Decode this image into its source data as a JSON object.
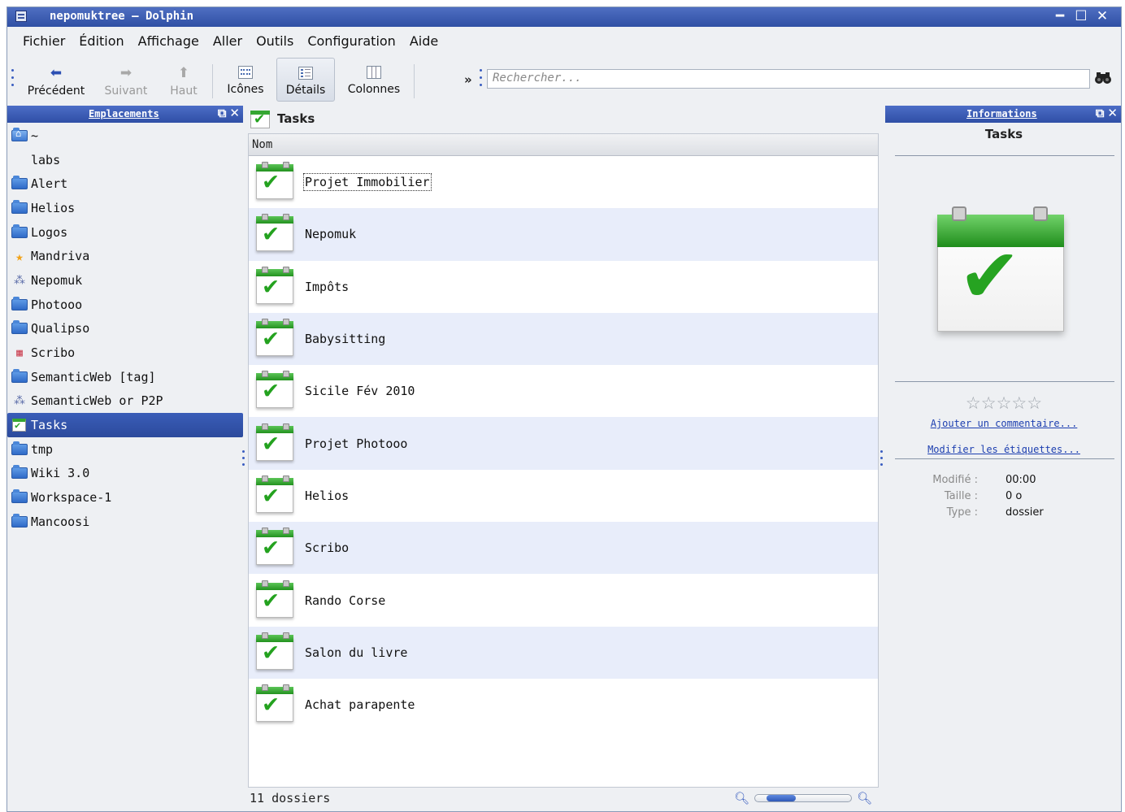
{
  "window": {
    "title": "nepomuktree – Dolphin",
    "controls": [
      "━",
      "☐",
      "✕"
    ]
  },
  "menu": [
    "Fichier",
    "Édition",
    "Affichage",
    "Aller",
    "Outils",
    "Configuration",
    "Aide"
  ],
  "toolbar": {
    "back": "Précédent",
    "forward": "Suivant",
    "up": "Haut",
    "icons": "Icônes",
    "details": "Détails",
    "columns": "Colonnes",
    "more": "»",
    "search_placeholder": "Rechercher..."
  },
  "places": {
    "title": "Emplacements",
    "items": [
      {
        "label": "~",
        "icon": "home-folder-icon"
      },
      {
        "label": "labs",
        "icon": "search-folder-icon"
      },
      {
        "label": "Alert",
        "icon": "folder-icon"
      },
      {
        "label": "Helios",
        "icon": "folder-icon"
      },
      {
        "label": "Logos",
        "icon": "folder-icon"
      },
      {
        "label": "Mandriva",
        "icon": "star-icon"
      },
      {
        "label": "Nepomuk",
        "icon": "nepomuk-icon"
      },
      {
        "label": "Photooo",
        "icon": "folder-icon"
      },
      {
        "label": "Qualipso",
        "icon": "folder-icon"
      },
      {
        "label": "Scribo",
        "icon": "subtitle-icon"
      },
      {
        "label": "SemanticWeb [tag]",
        "icon": "folder-icon"
      },
      {
        "label": "SemanticWeb or P2P",
        "icon": "nepomuk-icon"
      },
      {
        "label": "Tasks",
        "icon": "tasks-icon",
        "selected": true
      },
      {
        "label": "tmp",
        "icon": "folder-icon"
      },
      {
        "label": "Wiki 3.0",
        "icon": "folder-icon"
      },
      {
        "label": "Workspace-1",
        "icon": "folder-icon"
      },
      {
        "label": "Mancoosi",
        "icon": "folder-icon"
      }
    ]
  },
  "location": {
    "label": "Tasks"
  },
  "list": {
    "column": "Nom",
    "rows": [
      "Projet Immobilier",
      "Nepomuk",
      "Impôts",
      "Babysitting",
      "Sicile Fév 2010",
      "Projet Photooo",
      "Helios",
      "Scribo",
      "Rando Corse",
      "Salon du livre",
      "Achat parapente"
    ],
    "focused_index": 0
  },
  "status": {
    "text": "11 dossiers",
    "zoom_level": 0.3
  },
  "info": {
    "header": "Informations",
    "title": "Tasks",
    "rating_stars": "☆☆☆☆☆",
    "add_comment": "Ajouter un commentaire...",
    "edit_tags": "Modifier les étiquettes...",
    "meta": [
      {
        "key": "Modifié :",
        "value": "00:00"
      },
      {
        "key": "Taille :",
        "value": "0 o"
      },
      {
        "key": "Type :",
        "value": "dossier"
      }
    ]
  },
  "colors": {
    "accent": "#2f4fa4",
    "selection": "#3a5db8",
    "alt_row": "#e8edfa",
    "task_green": "#26a321"
  }
}
